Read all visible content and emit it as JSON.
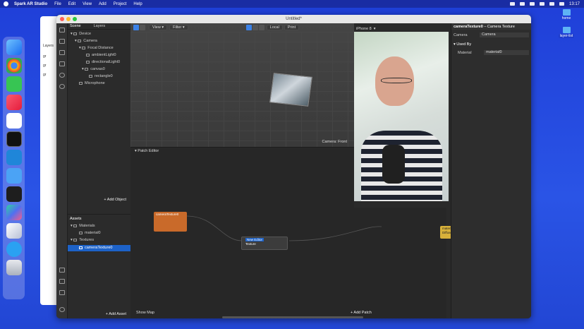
{
  "menubar": {
    "app": "Spark AR Studio",
    "items": [
      "File",
      "Edit",
      "View",
      "Add",
      "Project",
      "Help"
    ],
    "time": "13:17"
  },
  "desktop": {
    "icons": [
      {
        "label": "home"
      },
      {
        "label": "layer-list"
      }
    ]
  },
  "background_window": {
    "rows": [
      "Layers",
      "gr",
      "gr",
      "gr"
    ]
  },
  "window": {
    "title": "Untitled*"
  },
  "scene_panel": {
    "tabs": [
      "Scene",
      "Layers"
    ],
    "tree": [
      "Device",
      "Camera",
      "Focal Distance",
      "ambientLight0",
      "directionalLight0",
      "canvas0",
      "rectangle0",
      "Microphone"
    ],
    "add_object": "+ Add Object"
  },
  "assets_panel": {
    "title": "Assets",
    "tree": [
      "Materials",
      "material0",
      "Textures",
      "cameraTexture0"
    ],
    "add_asset": "+ Add Asset"
  },
  "viewport": {
    "view_label": "View",
    "filter_label": "Filter",
    "local_label": "Local",
    "print_label": "Print",
    "camera_label": "Camera: Front"
  },
  "patch_editor": {
    "title": "Patch Editor",
    "nodes": {
      "camera_texture": "cameraTexture0",
      "texture_node_title": "New Editor",
      "texture_port": "Texture",
      "material_title": "material0",
      "material_port": "Diffuse Texture"
    },
    "show_map": "Show Map",
    "add_patch": "+ Add Patch"
  },
  "preview": {
    "device": "iPhone 8"
  },
  "inspector": {
    "title": "cameraTexture0",
    "subtitle": "– Camera Texture",
    "camera_label": "Camera",
    "camera_value": "Camera",
    "used_by": "Used By",
    "material_label": "Material",
    "material_value": "material0"
  },
  "colors": {
    "accent": "#1d62c8",
    "node_orange": "#c96a2a",
    "node_yellow": "#d8b13a"
  }
}
